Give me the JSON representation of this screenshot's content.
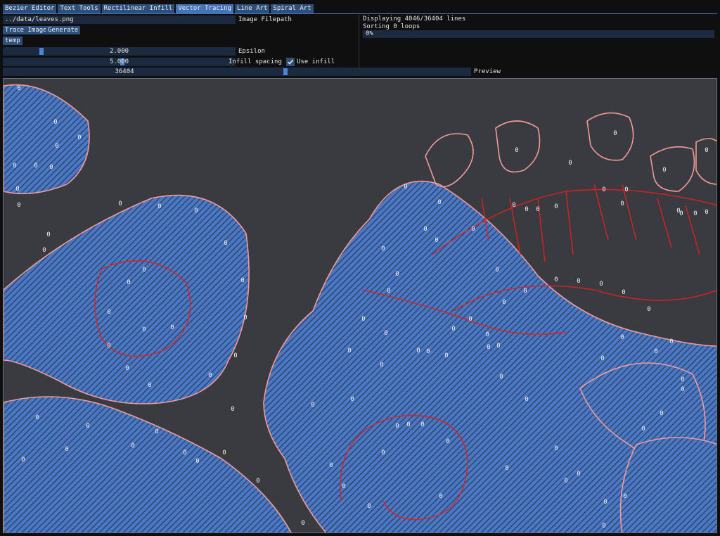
{
  "tabs": [
    {
      "label": "Bezier Editor",
      "active": false
    },
    {
      "label": "Text Tools",
      "active": false
    },
    {
      "label": "Rectilinear Infill",
      "active": false
    },
    {
      "label": "Vector Tracing",
      "active": true
    },
    {
      "label": "Line Art",
      "active": false
    },
    {
      "label": "Spiral Art",
      "active": false
    }
  ],
  "controls": {
    "filepath_value": "../data/leaves.png",
    "filepath_label": "Image Filepath",
    "trace_button": "Trace Image",
    "generate_button": "Generate",
    "temp_button": "temp",
    "epsilon_value": "2.000",
    "epsilon_label": "Epsilon",
    "infill_value": "5.000",
    "infill_label": "Infill spacing",
    "use_infill_label": "Use infill",
    "use_infill_checked": true,
    "preview_value": "36404",
    "preview_label": "Preview"
  },
  "status": {
    "displaying": "Displaying 4046/36404 lines",
    "sorting": "Sorting 0 loops",
    "progress_text": "0%",
    "progress_fraction": 0.0
  },
  "canvas": {
    "loop_marker": "0",
    "colors": {
      "background": "#3a3b40",
      "fill": "#4a78c4",
      "hatch": "#2a3a5a",
      "outline_light": "#f29a9a",
      "outline_red": "#d8221f"
    }
  }
}
